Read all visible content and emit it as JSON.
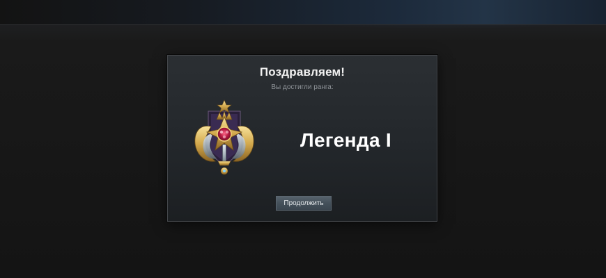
{
  "dialog": {
    "title": "Поздравляем!",
    "subtitle": "Вы достигли ранга:",
    "rank_name": "Легенда I",
    "continue_label": "Продолжить",
    "medal_icon": "legend-rank-medal-icon"
  },
  "colors": {
    "background": "#161616",
    "dialog_bg": "#25292d",
    "button_bg": "#4a5660",
    "medal_gold": "#d8b45a",
    "medal_gem": "#b0204a"
  }
}
